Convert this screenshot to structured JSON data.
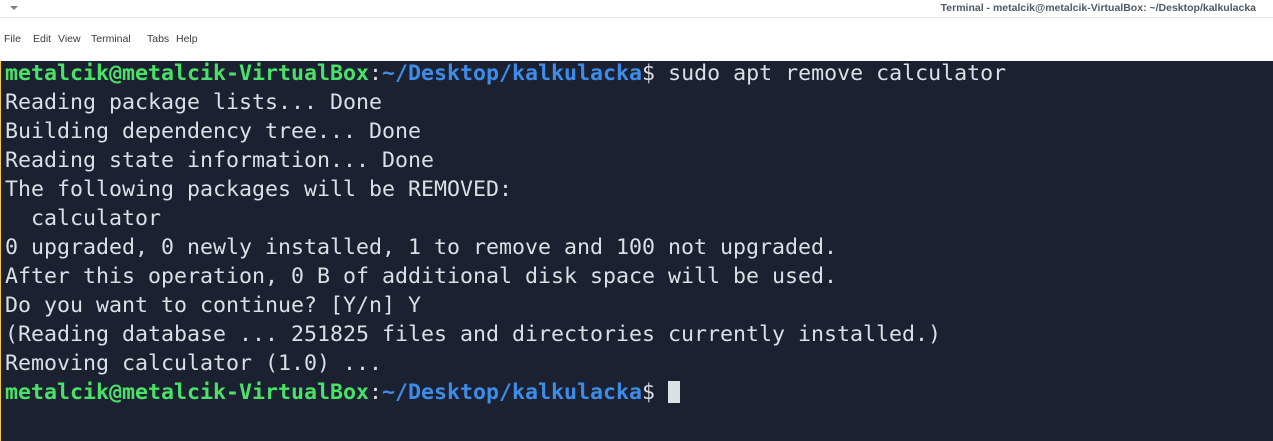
{
  "window": {
    "title": "Terminal - metalcik@metalcik-VirtualBox: ~/Desktop/kalkulacka",
    "menu_icon": "chevron-down-icon"
  },
  "menubar": {
    "items": [
      "File",
      "Edit",
      "View",
      "Terminal",
      "Tabs",
      "Help"
    ]
  },
  "terminal": {
    "colors": {
      "background": "#1b2130",
      "foreground": "#dcdfe4",
      "prompt_user_host": "#4ae168",
      "prompt_path": "#3d8de8"
    },
    "prompt": {
      "user_host": "metalcik@metalcik-VirtualBox",
      "colon": ":",
      "path": "~/Desktop/kalkulacka",
      "symbol": "$"
    },
    "command": " sudo apt remove calculator",
    "output": [
      "Reading package lists... Done",
      "Building dependency tree... Done",
      "Reading state information... Done",
      "The following packages will be REMOVED:",
      "  calculator",
      "0 upgraded, 0 newly installed, 1 to remove and 100 not upgraded.",
      "After this operation, 0 B of additional disk space will be used.",
      "Do you want to continue? [Y/n] Y",
      "(Reading database ... 251825 files and directories currently installed.)",
      "Removing calculator (1.0) ..."
    ],
    "final_prompt_tail": " "
  }
}
